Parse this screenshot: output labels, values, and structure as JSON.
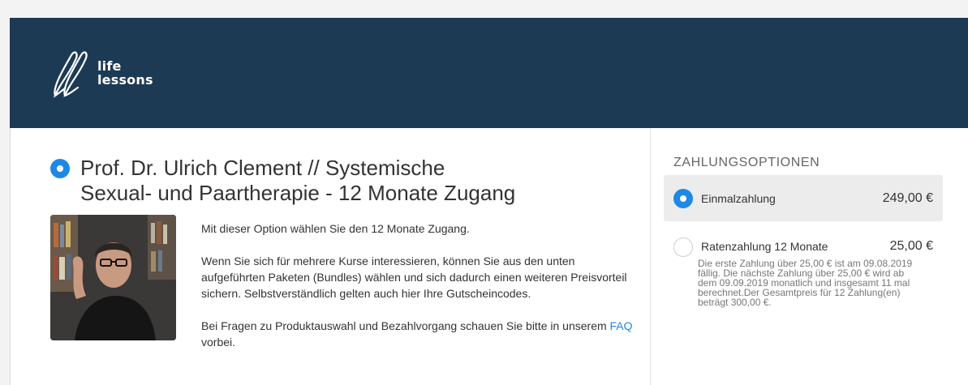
{
  "brand": {
    "logo_line1": "life",
    "logo_line2": "lessons"
  },
  "product": {
    "title_line1": "Prof. Dr. Ulrich Clement // Systemische",
    "title_line2": "Sexual- und Paartherapie - 12 Monate Zugang",
    "description": {
      "p1_before": "Mit dieser Option wählen Sie den ",
      "p1_strong": "12 Monate Zugang",
      "p1_after": ".",
      "p2": "Wenn Sie sich für mehrere Kurse interessieren, können Sie aus den unten aufgeführten Paketen (Bundles) wählen und sich dadurch einen weiteren Preisvorteil sichern. Selbstverständlich gelten auch hier Ihre Gutscheincodes.",
      "p3_before": "Bei Fragen zu Produktauswahl und Bezahlvorgang schauen Sie bitte in unserem ",
      "p3_link": "FAQ",
      "p3_after": " vorbei."
    }
  },
  "payment": {
    "heading": "ZAHLUNGSOPTIONEN",
    "options": [
      {
        "label": "Einmalzahlung",
        "price": "249,00 €",
        "selected": true
      },
      {
        "label": "Ratenzahlung 12 Monate",
        "price": "25,00 €",
        "selected": false,
        "note": "Die erste Zahlung über 25,00 € ist am 09.08.2019 fällig. Die nächste Zahlung über 25,00 € wird ab dem 09.09.2019 monatlich und insgesamt 11 mal berechnet.Der Gesamtpreis für 12 Zahlung(en) beträgt 300,00 €."
      }
    ]
  },
  "colors": {
    "header_bg": "#1d3a55",
    "accent": "#1e88e5"
  }
}
